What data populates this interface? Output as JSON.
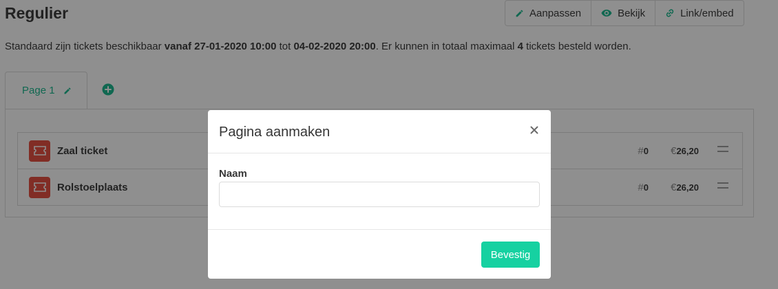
{
  "header": {
    "title": "Regulier",
    "buttons": {
      "edit": "Aanpassen",
      "view": "Bekijk",
      "link": "Link/embed"
    }
  },
  "description": {
    "part1": "Standaard zijn tickets beschikbaar ",
    "from": "vanaf 27-01-2020 10:00",
    "part2": " tot ",
    "until": "04-02-2020 20:00",
    "part3": ". Er kunnen in totaal maximaal ",
    "max": "4",
    "part4": " tickets besteld worden."
  },
  "tabs": [
    {
      "label": "Page 1"
    }
  ],
  "tickets": [
    {
      "name": "Zaal ticket",
      "count_symbol": "#",
      "count": "0",
      "price_symbol": "€",
      "price": "26,20"
    },
    {
      "name": "Rolstoelplaats",
      "count_symbol": "#",
      "count": "0",
      "price_symbol": "€",
      "price": "26,20"
    }
  ],
  "modal": {
    "title": "Pagina aanmaken",
    "field_label": "Naam",
    "field_value": "",
    "field_placeholder": "",
    "confirm_label": "Bevestig"
  },
  "colors": {
    "accent": "#16b78c",
    "confirm": "#16d1a1",
    "ticket_icon": "#e64a3c"
  }
}
